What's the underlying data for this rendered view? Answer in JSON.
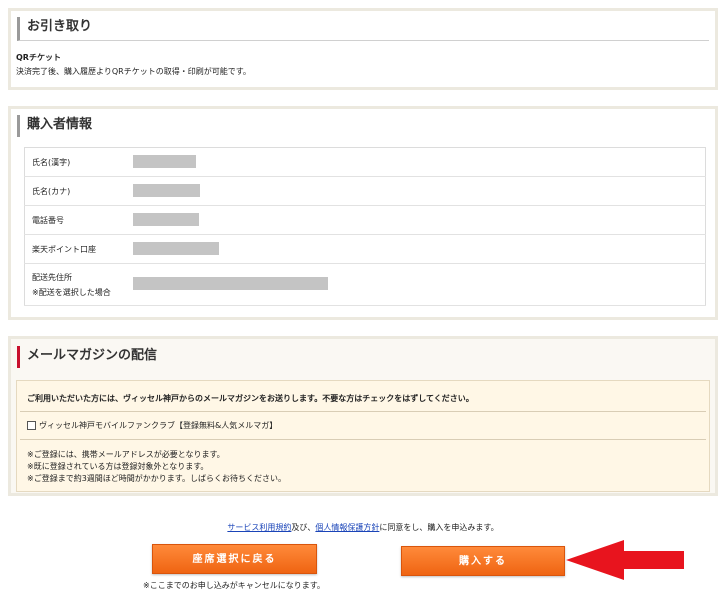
{
  "pickup": {
    "title": "お引き取り",
    "subtitle": "QRチケット",
    "description": "決済完了後、購入履歴よりQRチケットの取得・印刷が可能です。"
  },
  "buyer": {
    "title": "購入者情報",
    "rows": [
      {
        "label": "氏名(漢字)",
        "label2": ""
      },
      {
        "label": "氏名(カナ)",
        "label2": ""
      },
      {
        "label": "電話番号",
        "label2": ""
      },
      {
        "label": "楽天ポイント口座",
        "label2": ""
      },
      {
        "label": "配送先住所",
        "label2": "※配送を選択した場合"
      }
    ]
  },
  "mail": {
    "title": "メールマガジンの配信",
    "notice": "ご利用いただいた方には、ヴィッセル神戸からのメールマガジンをお送りします。不要な方はチェックをはずしてください。",
    "checkbox_label": "ヴィッセル神戸モバイルファンクラブ【登録無料&人気メルマガ】",
    "notes": [
      "※ご登録には、携帯メールアドレスが必要となります。",
      "※既に登録されている方は登録対象外となります。",
      "※ご登録まで約3週間ほど時間がかかります。しばらくお待ちください。"
    ]
  },
  "agreement": {
    "link1": "サービス利用規約",
    "text1": "及び、",
    "link2": "個人情報保護方針",
    "text2": "に同意をし、購入を申込みます。"
  },
  "buttons": {
    "back": "座席選択に戻る",
    "buy": "購入する",
    "cancel_note": "※ここまでのお申し込みがキャンセルになります。"
  },
  "colors": {
    "button": "#f27020",
    "arrow": "#e8141e",
    "heading_accent": "#c8102e"
  }
}
